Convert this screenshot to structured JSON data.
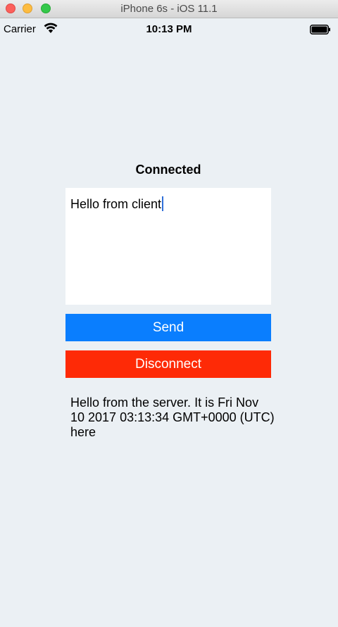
{
  "window": {
    "title": "iPhone 6s - iOS 11.1"
  },
  "status_bar": {
    "carrier": "Carrier",
    "time": "10:13 PM",
    "icons": [
      "wifi-icon",
      "battery-icon"
    ]
  },
  "app": {
    "connection_status": "Connected",
    "message_input": {
      "value": "Hello from client"
    },
    "send_button": {
      "label": "Send",
      "color": "#0a7efe"
    },
    "disconnect_button": {
      "label": "Disconnect",
      "color": "#fe2a06"
    },
    "server_message": "Hello from the server. It is Fri Nov 10 2017 03:13:34 GMT+0000 (UTC) here"
  }
}
